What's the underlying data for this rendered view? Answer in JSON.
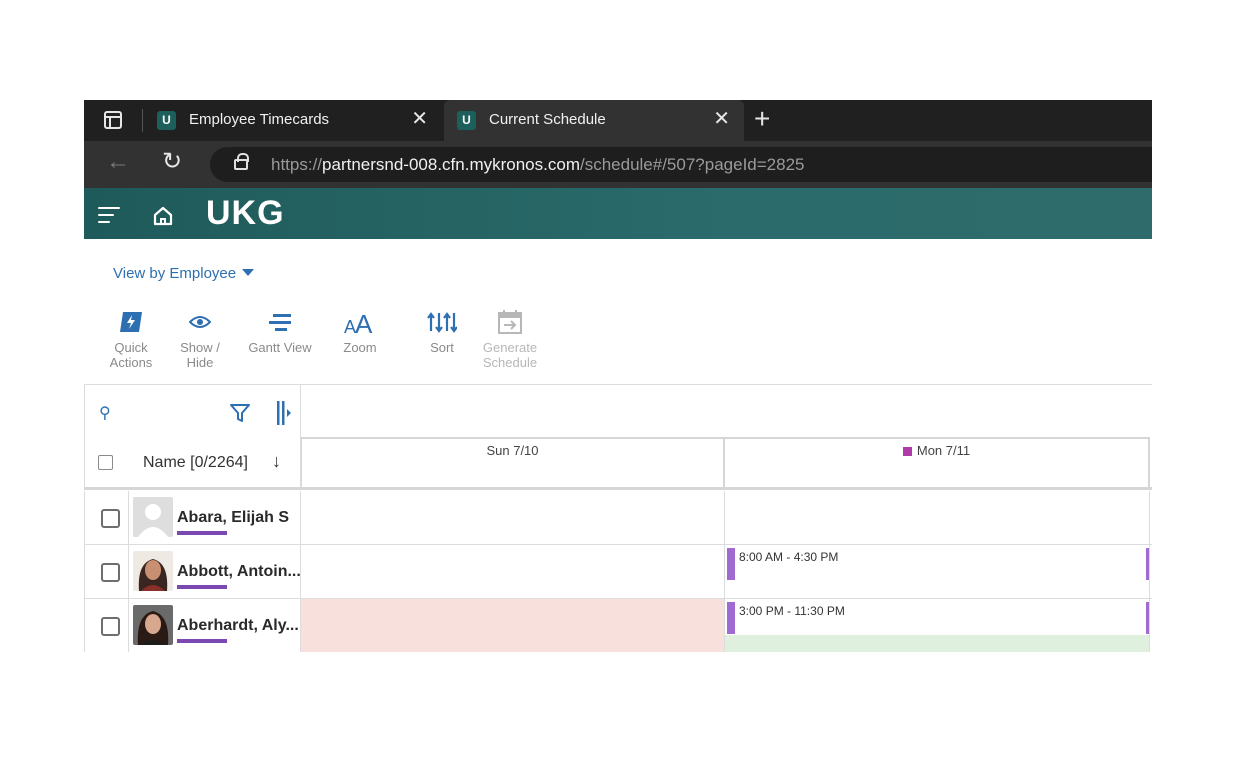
{
  "browser": {
    "tabs": [
      {
        "title": "Employee Timecards",
        "favicon": "U"
      },
      {
        "title": "Current Schedule",
        "favicon": "U"
      }
    ],
    "url_prefix": "https://",
    "url_host": "partnersnd-008.cfn.mykronos.com",
    "url_path": "/schedule#/507?pageId=2825"
  },
  "app": {
    "logo": "UKG"
  },
  "view_selector": "View by Employee",
  "toolbar": {
    "quick_actions": {
      "line1": "Quick",
      "line2": "Actions"
    },
    "show_hide": {
      "line1": "Show /",
      "line2": "Hide"
    },
    "gantt_view": "Gantt View",
    "zoom": "Zoom",
    "sort": "Sort",
    "generate_schedule": {
      "line1": "Generate",
      "line2": "Schedule"
    }
  },
  "grid": {
    "name_header": "Name [0/2264]",
    "days": [
      {
        "label": "Sun 7/10"
      },
      {
        "label": "Mon 7/11",
        "marker_color": "#b03aa8"
      }
    ],
    "rows": [
      {
        "name": "Abara, Elijah S",
        "shifts": [
          "",
          ""
        ]
      },
      {
        "name": "Abbott, Antoin...",
        "shifts": [
          "",
          "8:00 AM - 4:30 PM"
        ]
      },
      {
        "name": "Aberhardt, Aly...",
        "shifts": [
          "",
          "3:00 PM - 11:30 PM"
        ]
      }
    ]
  },
  "colors": {
    "header_teal": "#1f5a5a",
    "link_blue": "#2d6fb0",
    "shift_purple": "#a06bd0",
    "employee_bar": "#7a48b0",
    "unavailable_pink": "#f8e0dd"
  }
}
